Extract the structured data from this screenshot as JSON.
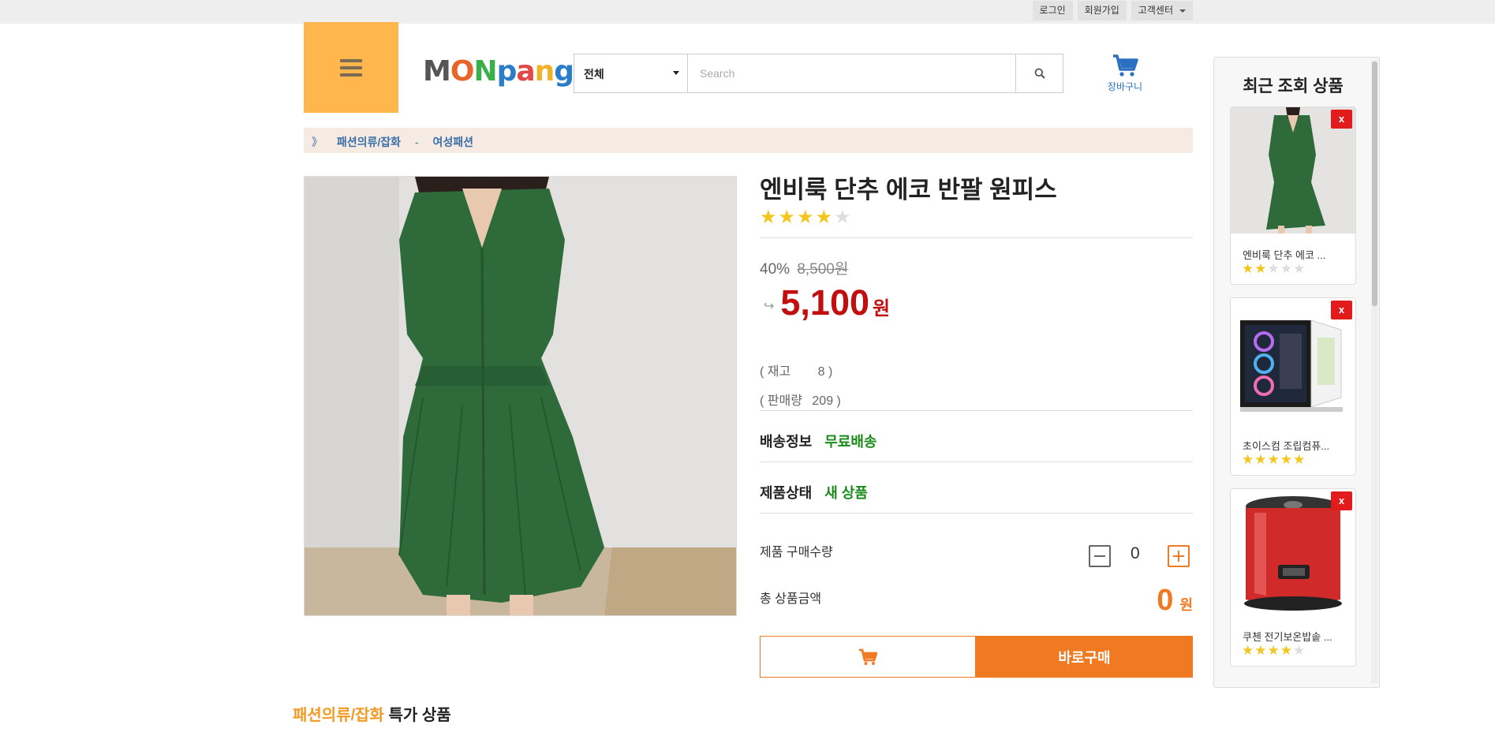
{
  "topbar": {
    "login": "로그인",
    "signup": "회원가입",
    "support": "고객센터"
  },
  "header": {
    "logo": [
      "M",
      "O",
      "N",
      "p",
      "a",
      "n",
      "g"
    ],
    "search_category": "전체",
    "search_placeholder": "Search",
    "cart_label": "장바구니"
  },
  "breadcrumb": {
    "arrow": "》",
    "level1": "패션의류/잡화",
    "sep": "-",
    "level2": "여성패션"
  },
  "product": {
    "title": "엔비룩 단추 에코 반팔 원피스",
    "rating": 4,
    "rating_max": 5,
    "discount": "40%",
    "original_price": "8,500원",
    "price_arrow": "↪",
    "price": "5,100",
    "price_unit": "원",
    "stock_label": "( 재고",
    "stock_value": "8 )",
    "sold_label": "( 판매량",
    "sold_value": "209 )",
    "shipping_label": "배송정보",
    "shipping_value": "무료배송",
    "condition_label": "제품상태",
    "condition_value": "새 상품",
    "qty_label": "제품 구매수량",
    "qty_value": "0",
    "total_label": "총 상품금액",
    "total_value": "0",
    "total_unit": "원",
    "buy_label": "바로구매"
  },
  "section": {
    "highlight": "패션의류/잡화",
    "rest": " 특가 상품"
  },
  "recent": {
    "title": "최근 조회 상품",
    "remove_label": "x",
    "items": [
      {
        "name": "엔비룩 단추 에코 ...",
        "rating": 2
      },
      {
        "name": "초이스컴 조립컴퓨...",
        "rating": 5
      },
      {
        "name": "쿠첸 전기보온밥솥 ...",
        "rating": 4
      }
    ]
  },
  "colors": {
    "accent": "#f07a22",
    "menu": "#ffb64d",
    "price": "#c10f0f",
    "link": "#3b6fa8",
    "green": "#1a8a1a"
  },
  "icons": [
    "menu-icon",
    "search-icon",
    "cart-icon",
    "star-icon",
    "minus-icon",
    "plus-icon"
  ]
}
